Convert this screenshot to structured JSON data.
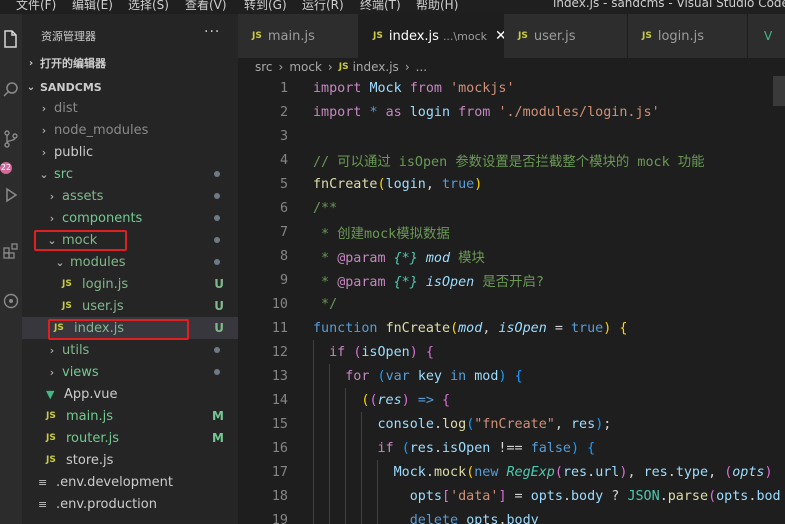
{
  "menubar": {
    "items": [
      "文件(F)",
      "编辑(E)",
      "选择(S)",
      "查看(V)",
      "转到(G)",
      "运行(R)",
      "终端(T)",
      "帮助(H)"
    ],
    "window_title": "index.js - sandcms - Visual Studio Code"
  },
  "activity_bar": {
    "icons": [
      "explorer-icon",
      "search-icon",
      "source-control-icon",
      "run-debug-icon",
      "extensions-icon",
      "remote-icon"
    ],
    "scm_badge": "22"
  },
  "sidebar": {
    "title": "资源管理器",
    "more": "···",
    "open_editors_label": "打开的编辑器",
    "project_label": "SANDCMS",
    "items": [
      {
        "label": "dist",
        "type": "folder",
        "expanded": false,
        "depth": 0,
        "dim": true
      },
      {
        "label": "node_modules",
        "type": "folder",
        "expanded": false,
        "depth": 0,
        "dim": true
      },
      {
        "label": "public",
        "type": "folder",
        "expanded": false,
        "depth": 0
      },
      {
        "label": "src",
        "type": "folder",
        "expanded": true,
        "depth": 0,
        "color": "green",
        "dot": true
      },
      {
        "label": "assets",
        "type": "folder",
        "expanded": false,
        "depth": 1,
        "color": "teal",
        "dot": true
      },
      {
        "label": "components",
        "type": "folder",
        "expanded": false,
        "depth": 1,
        "color": "green",
        "dot": true
      },
      {
        "label": "mock",
        "type": "folder",
        "expanded": true,
        "depth": 1,
        "color": "teal",
        "dot": true
      },
      {
        "label": "modules",
        "type": "folder",
        "expanded": true,
        "depth": 2,
        "color": "teal",
        "dot": true
      },
      {
        "label": "login.js",
        "type": "js",
        "depth": 3,
        "color": "teal",
        "deco": "U"
      },
      {
        "label": "user.js",
        "type": "js",
        "depth": 3,
        "color": "teal",
        "deco": "U"
      },
      {
        "label": "index.js",
        "type": "js",
        "depth": 2,
        "color": "teal",
        "deco": "U",
        "active": true
      },
      {
        "label": "utils",
        "type": "folder",
        "expanded": false,
        "depth": 1,
        "color": "teal",
        "dot": true
      },
      {
        "label": "views",
        "type": "folder",
        "expanded": false,
        "depth": 1,
        "color": "green",
        "dot": true
      },
      {
        "label": "App.vue",
        "type": "vue",
        "depth": 1
      },
      {
        "label": "main.js",
        "type": "js",
        "depth": 1,
        "color": "green",
        "deco": "M"
      },
      {
        "label": "router.js",
        "type": "js",
        "depth": 1,
        "color": "green",
        "deco": "M"
      },
      {
        "label": "store.js",
        "type": "js",
        "depth": 1
      },
      {
        "label": ".env.development",
        "type": "env",
        "depth": 0
      },
      {
        "label": ".env.production",
        "type": "env",
        "depth": 0
      }
    ]
  },
  "tabs": [
    {
      "label": "main.js",
      "active": false
    },
    {
      "label": "index.js",
      "hint": "...\\mock",
      "active": true
    },
    {
      "label": "user.js",
      "active": false
    },
    {
      "label": "login.js",
      "active": false
    }
  ],
  "breadcrumb": [
    "src",
    "mock",
    "index.js",
    "..."
  ],
  "code_lines": [
    {
      "n": "1",
      "html": "<span class='ctl'>import</span> <span class='var'>Mock</span> <span class='ctl'>from</span> <span class='str'>'mockjs'</span>"
    },
    {
      "n": "2",
      "html": "<span class='ctl'>import</span> <span class='kw'>*</span> <span class='ctl'>as</span> <span class='var'>login</span> <span class='ctl'>from</span> <span class='str'>'./modules/login.js'</span>"
    },
    {
      "n": "3",
      "html": ""
    },
    {
      "n": "4",
      "html": "<span class='cm'>// 可以通过 isOpen 参数设置是否拦截整个模块的 mock 功能</span>"
    },
    {
      "n": "5",
      "html": "<span class='fn'>fnCreate</span><span class='br1'>(</span><span class='var'>login</span>, <span class='kw'>true</span><span class='br1'>)</span>"
    },
    {
      "n": "6",
      "html": "<span class='cm'>/**</span>"
    },
    {
      "n": "7",
      "html": "<span class='cm'> * 创建mock模拟数据</span>"
    },
    {
      "n": "8",
      "html": "<span class='cm'> * </span><span class='jsdoc'>@param</span> <span class='doctype'>{*}</span> <span class='par'>mod</span> <span class='cm'>模块</span>"
    },
    {
      "n": "9",
      "html": "<span class='cm'> * </span><span class='jsdoc'>@param</span> <span class='doctype'>{*}</span> <span class='par'>isOpen</span> <span class='cm'>是否开启?</span>"
    },
    {
      "n": "10",
      "html": "<span class='cm'> */</span>"
    },
    {
      "n": "11",
      "html": "<span class='kw'>function</span> <span class='fn'>fnCreate</span><span class='br1'>(</span><span class='par'>mod</span>, <span class='par'>isOpen</span> = <span class='kw'>true</span><span class='br1'>)</span> <span class='br1'>{</span>"
    },
    {
      "n": "12",
      "html": "  <span class='ctl'>if</span> <span class='br2'>(</span><span class='var'>isOpen</span><span class='br2'>)</span> <span class='br2'>{</span>"
    },
    {
      "n": "13",
      "html": "    <span class='ctl'>for</span> <span class='br3'>(</span><span class='kw'>var</span> <span class='var'>key</span> <span class='kw'>in</span> <span class='var'>mod</span><span class='br3'>)</span> <span class='br3'>{</span>"
    },
    {
      "n": "14",
      "html": "      <span class='br1'>(</span><span class='br2'>(</span><span class='par'>res</span><span class='br2'>)</span> <span class='kw'>=&gt;</span> <span class='br2'>{</span>"
    },
    {
      "n": "15",
      "html": "        <span class='var'>console</span>.<span class='fn'>log</span><span class='br3'>(</span><span class='str'>\"fnCreate\"</span>, <span class='var'>res</span><span class='br3'>)</span>;"
    },
    {
      "n": "16",
      "html": "        <span class='ctl'>if</span> <span class='br3'>(</span><span class='var'>res</span>.<span class='var'>isOpen</span> !== <span class='kw'>false</span><span class='br3'>)</span> <span class='br3'>{</span>"
    },
    {
      "n": "17",
      "html": "          <span class='var'>Mock</span>.<span class='fn'>mock</span><span class='br1'>(</span><span class='kw'>new</span> <span class='cls'>RegExp</span><span class='br2'>(</span><span class='var'>res</span>.<span class='var'>url</span><span class='br2'>)</span>, <span class='var'>res</span>.<span class='var'>type</span>, <span class='br2'>(</span><span class='par'>opts</span><span class='br2'>)</span>"
    },
    {
      "n": "18",
      "html": "            <span class='var'>opts</span><span class='br2'>[</span><span class='str'>'data'</span><span class='br2'>]</span> = <span class='var'>opts</span>.<span class='var'>body</span> ? <span class='cls' style='font-style:normal'>JSON</span>.<span class='fn'>parse</span><span class='br2'>(</span><span class='var'>opts</span>.<span class='var'>bod</span>"
    },
    {
      "n": "19",
      "html": "            <span class='kw'>delete</span> <span class='var'>opts</span>.<span class='var'>body</span>"
    }
  ],
  "colors": {
    "annotation": "#e02020",
    "git_untracked": "#73c991",
    "git_modified": "#81b88b"
  }
}
